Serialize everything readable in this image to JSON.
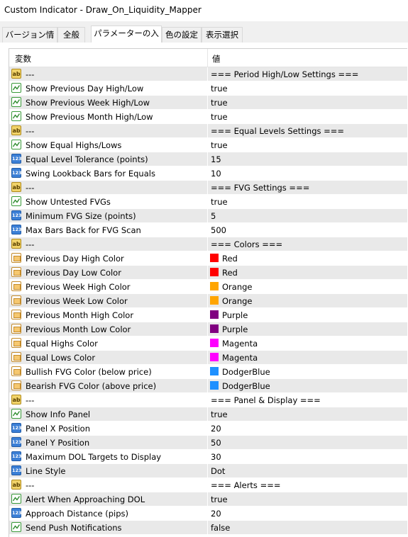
{
  "window": {
    "title": "Custom Indicator - Draw_On_Liquidity_Mapper"
  },
  "tabs": [
    {
      "label": "バージョン情報",
      "active": false
    },
    {
      "label": "全般",
      "active": false
    },
    {
      "label": "パラメーターの入力",
      "active": true
    },
    {
      "label": "色の設定",
      "active": false
    },
    {
      "label": "表示選択",
      "active": false
    }
  ],
  "table": {
    "headers": {
      "variable": "変数",
      "value": "値"
    },
    "rows": [
      {
        "type": "string",
        "name": "---",
        "value": "=== Period High/Low Settings ==="
      },
      {
        "type": "bool",
        "name": "Show Previous Day High/Low",
        "value": "true"
      },
      {
        "type": "bool",
        "name": "Show Previous Week High/Low",
        "value": "true"
      },
      {
        "type": "bool",
        "name": "Show Previous Month High/Low",
        "value": "true"
      },
      {
        "type": "string",
        "name": "---",
        "value": "=== Equal Levels Settings ==="
      },
      {
        "type": "bool",
        "name": "Show Equal Highs/Lows",
        "value": "true"
      },
      {
        "type": "number",
        "name": "Equal Level Tolerance (points)",
        "value": "15"
      },
      {
        "type": "number",
        "name": "Swing Lookback Bars for Equals",
        "value": "10"
      },
      {
        "type": "string",
        "name": "---",
        "value": "=== FVG Settings ==="
      },
      {
        "type": "bool",
        "name": "Show Untested FVGs",
        "value": "true"
      },
      {
        "type": "number",
        "name": "Minimum FVG Size (points)",
        "value": "5"
      },
      {
        "type": "number",
        "name": "Max Bars Back for FVG Scan",
        "value": "500"
      },
      {
        "type": "string",
        "name": "---",
        "value": "=== Colors ==="
      },
      {
        "type": "color",
        "name": "Previous Day High Color",
        "value": "Red",
        "swatch": "#ff0000"
      },
      {
        "type": "color",
        "name": "Previous Day Low Color",
        "value": "Red",
        "swatch": "#ff0000"
      },
      {
        "type": "color",
        "name": "Previous Week High Color",
        "value": "Orange",
        "swatch": "#ffa500"
      },
      {
        "type": "color",
        "name": "Previous Week Low Color",
        "value": "Orange",
        "swatch": "#ffa500"
      },
      {
        "type": "color",
        "name": "Previous Month High Color",
        "value": "Purple",
        "swatch": "#800080"
      },
      {
        "type": "color",
        "name": "Previous Month Low Color",
        "value": "Purple",
        "swatch": "#800080"
      },
      {
        "type": "color",
        "name": "Equal Highs Color",
        "value": "Magenta",
        "swatch": "#ff00ff"
      },
      {
        "type": "color",
        "name": "Equal Lows Color",
        "value": "Magenta",
        "swatch": "#ff00ff"
      },
      {
        "type": "color",
        "name": "Bullish FVG Color (below price)",
        "value": "DodgerBlue",
        "swatch": "#1e90ff"
      },
      {
        "type": "color",
        "name": "Bearish FVG Color (above price)",
        "value": "DodgerBlue",
        "swatch": "#1e90ff"
      },
      {
        "type": "string",
        "name": "---",
        "value": "=== Panel & Display ==="
      },
      {
        "type": "bool",
        "name": "Show Info Panel",
        "value": "true"
      },
      {
        "type": "number",
        "name": "Panel X Position",
        "value": "20"
      },
      {
        "type": "number",
        "name": "Panel Y Position",
        "value": "50"
      },
      {
        "type": "number",
        "name": "Maximum DOL Targets to Display",
        "value": "30"
      },
      {
        "type": "number",
        "name": "Line Style",
        "value": "Dot"
      },
      {
        "type": "string",
        "name": "---",
        "value": "=== Alerts ==="
      },
      {
        "type": "bool",
        "name": "Alert When Approaching DOL",
        "value": "true"
      },
      {
        "type": "number",
        "name": "Approach Distance (pips)",
        "value": "20"
      },
      {
        "type": "bool",
        "name": "Send Push Notifications",
        "value": "false"
      }
    ]
  },
  "icons": {
    "string": "ab-string-icon",
    "bool": "bool-icon",
    "number": "number-123-icon",
    "color": "color-icon"
  },
  "icon_text": {
    "ab": "ab",
    "num": "123"
  }
}
